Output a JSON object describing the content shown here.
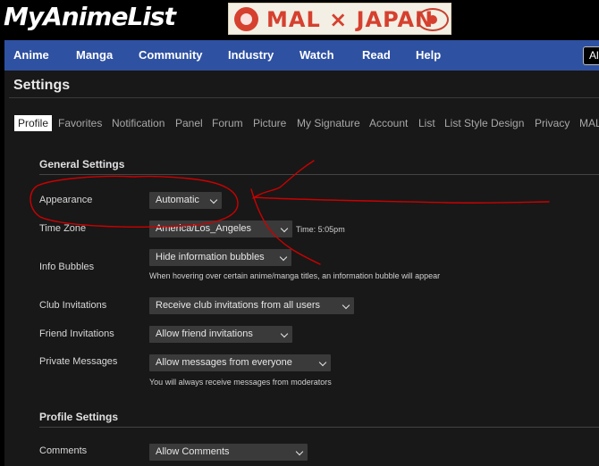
{
  "header": {
    "logo_text": "MyAnimeList",
    "banner_text": "MAL × JAPAN"
  },
  "nav": {
    "items": [
      "Anime",
      "Manga",
      "Community",
      "Industry",
      "Watch",
      "Read",
      "Help"
    ],
    "search_text": "All"
  },
  "page": {
    "title": "Settings"
  },
  "tabs": {
    "items": [
      "Profile",
      "Favorites",
      "Notification",
      "Panel",
      "Forum",
      "Picture",
      "My Signature",
      "Account",
      "List",
      "List Style Design",
      "Privacy",
      "MAL"
    ],
    "active": "Profile"
  },
  "general": {
    "title": "General Settings",
    "appearance": {
      "label": "Appearance",
      "value": "Automatic"
    },
    "timezone": {
      "label": "Time Zone",
      "value": "America/Los_Angeles",
      "time": "Time: 5:05pm"
    },
    "bubbles": {
      "label": "Info Bubbles",
      "value": "Hide information bubbles",
      "note": "When hovering over certain anime/manga titles, an information bubble will appear"
    },
    "club": {
      "label": "Club Invitations",
      "value": "Receive club invitations from all users"
    },
    "friend": {
      "label": "Friend Invitations",
      "value": "Allow friend invitations"
    },
    "messages": {
      "label": "Private Messages",
      "value": "Allow messages from everyone",
      "note": "You will always receive messages from moderators"
    }
  },
  "profile": {
    "title": "Profile Settings",
    "comments": {
      "label": "Comments",
      "value": "Allow Comments"
    }
  },
  "annotation_color": "#cc0000"
}
